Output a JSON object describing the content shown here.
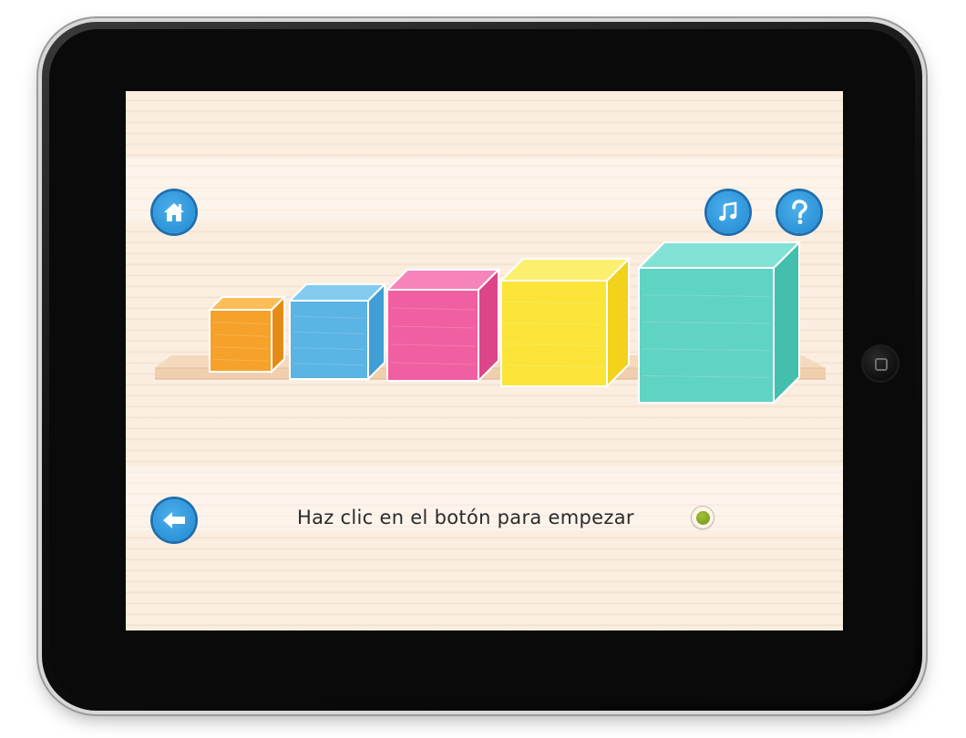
{
  "screen": {
    "instruction_text": "Haz clic en el botón para empezar"
  },
  "buttons": {
    "home_icon": "home-icon",
    "music_icon": "music-note-icon",
    "help_icon": "question-mark-icon",
    "back_icon": "arrow-left-icon",
    "start_icon": "green-dot-icon"
  },
  "cubes": [
    {
      "color_name": "orange",
      "front": "#f6a12a",
      "top": "#fbbd57",
      "side": "#e48c16"
    },
    {
      "color_name": "blue",
      "front": "#5ab4e4",
      "top": "#82cbef",
      "side": "#3f9ed3"
    },
    {
      "color_name": "pink",
      "front": "#f05fa1",
      "top": "#f684bb",
      "side": "#dc4588"
    },
    {
      "color_name": "yellow",
      "front": "#fbe437",
      "top": "#fcef6d",
      "side": "#f2d21a"
    },
    {
      "color_name": "teal",
      "front": "#5fd3c4",
      "top": "#82e1d5",
      "side": "#44bfae"
    }
  ],
  "colors": {
    "button_blue": "#2d94d9",
    "button_ring": "#1e6fb0",
    "screen_background": "#fbeee0",
    "shelf_wood": "#f1d3b5",
    "start_dot_green": "#7fa11e"
  }
}
